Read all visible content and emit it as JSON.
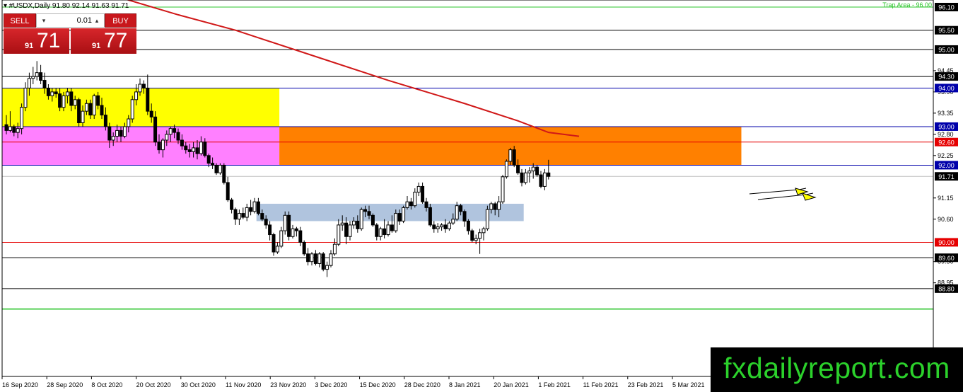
{
  "symbol_line": "▾ #USDX,Daily  91.80 92.14 91.63 91.71",
  "trade_panel": {
    "sell_label": "SELL",
    "buy_label": "BUY",
    "lot_value": "0.01",
    "lot_down_glyph": "▾",
    "lot_up_glyph": "▴",
    "sell_price_small": "91",
    "sell_price_big": "71",
    "buy_price_small": "91",
    "buy_price_big": "77"
  },
  "watermark": "fxdailyreport.com",
  "chart_data": {
    "type": "candlestick",
    "symbol": "#USDX",
    "timeframe": "Daily",
    "ylim": [
      88.5,
      96.15
    ],
    "price_ticks": [
      "94.45",
      "93.90",
      "93.35",
      "92.80",
      "92.25",
      "91.15",
      "90.60",
      "89.50",
      "88.95"
    ],
    "level_labels": [
      {
        "value": 96.1,
        "label": "96.10",
        "style": "solid",
        "color": "#000000",
        "line": "#2bc52b"
      },
      {
        "value": 95.5,
        "label": "95.50",
        "style": "solid",
        "color": "#000000",
        "line": "#000000"
      },
      {
        "value": 95.0,
        "label": "95.00",
        "style": "solid",
        "color": "#000000",
        "line": "#000000"
      },
      {
        "value": 94.3,
        "label": "94.30",
        "style": "solid",
        "color": "#000000",
        "line": "#000000"
      },
      {
        "value": 94.0,
        "label": "94.00",
        "style": "solid",
        "color": "#0000aa",
        "line": "#0000aa"
      },
      {
        "value": 93.0,
        "label": "93.00",
        "style": "solid",
        "color": "#0000aa",
        "line": "#0000aa"
      },
      {
        "value": 92.6,
        "label": "92.60",
        "style": "solid",
        "color": "#e60000",
        "line": "#e60000"
      },
      {
        "value": 92.0,
        "label": "92.00",
        "style": "solid",
        "color": "#0000aa",
        "line": "#0000aa"
      },
      {
        "value": 91.71,
        "label": "91.71",
        "style": "solid",
        "color": "#000000",
        "line": "#c0c0c0"
      },
      {
        "value": 90.0,
        "label": "90.00",
        "style": "solid",
        "color": "#e60000",
        "line": "#e60000"
      },
      {
        "value": 89.6,
        "label": "89.60",
        "style": "solid",
        "color": "#000000",
        "line": "#000000"
      },
      {
        "value": 88.8,
        "label": "88.80",
        "style": "solid",
        "color": "#000000",
        "line": "#000000"
      }
    ],
    "extra_lines": [
      {
        "value": 88.27,
        "color": "#2bc52b"
      }
    ],
    "annotations": [
      {
        "text": "Trap Area - 96.00",
        "color": "#2bc52b"
      }
    ],
    "zones": [
      {
        "name": "yellow",
        "x_from": 0,
        "x_to": 72,
        "y_from": 93.0,
        "y_to": 94.0,
        "color": "#ffff00"
      },
      {
        "name": "pink",
        "x_from": 0,
        "x_to": 72,
        "y_from": 92.0,
        "y_to": 93.0,
        "color": "#ff80ff"
      },
      {
        "name": "orange",
        "x_from": 72,
        "x_to": 193,
        "y_from": 92.0,
        "y_to": 93.0,
        "color": "#ff8000"
      },
      {
        "name": "steel-blue",
        "x_from": 66,
        "x_to": 136,
        "y_from": 90.55,
        "y_to": 91.0,
        "color": "#b0c4de"
      }
    ],
    "x_labels": [
      "16 Sep 2020",
      "28 Sep 2020",
      "8 Oct 2020",
      "20 Oct 2020",
      "30 Oct 2020",
      "11 Nov 2020",
      "23 Nov 2020",
      "3 Dec 2020",
      "15 Dec 2020",
      "28 Dec 2020",
      "8 Jan 2021",
      "20 Jan 2021",
      "1 Feb 2021",
      "11 Feb 2021",
      "23 Feb 2021",
      "5 Mar 2021"
    ],
    "candles": [
      [
        93.05,
        93.3,
        92.8,
        92.9
      ],
      [
        92.9,
        93.4,
        92.85,
        93.0
      ],
      [
        93.0,
        93.05,
        92.75,
        92.85
      ],
      [
        92.85,
        93.1,
        92.7,
        92.95
      ],
      [
        92.95,
        93.6,
        92.8,
        93.5
      ],
      [
        93.5,
        94.15,
        93.4,
        94.0
      ],
      [
        94.0,
        94.4,
        93.8,
        94.25
      ],
      [
        94.25,
        94.55,
        94.1,
        94.3
      ],
      [
        94.3,
        94.7,
        94.2,
        94.4
      ],
      [
        94.4,
        94.6,
        94.1,
        94.2
      ],
      [
        94.2,
        94.4,
        93.85,
        94.0
      ],
      [
        94.0,
        94.1,
        93.7,
        93.8
      ],
      [
        93.8,
        94.0,
        93.65,
        93.9
      ],
      [
        93.9,
        94.0,
        93.75,
        93.85
      ],
      [
        93.85,
        94.0,
        93.4,
        93.5
      ],
      [
        93.5,
        93.9,
        93.4,
        93.8
      ],
      [
        93.8,
        94.0,
        93.6,
        93.9
      ],
      [
        93.9,
        94.0,
        93.4,
        93.55
      ],
      [
        93.55,
        93.8,
        93.45,
        93.7
      ],
      [
        93.7,
        93.75,
        93.0,
        93.1
      ],
      [
        93.1,
        93.55,
        93.0,
        93.4
      ],
      [
        93.4,
        93.7,
        93.3,
        93.6
      ],
      [
        93.6,
        93.7,
        93.2,
        93.3
      ],
      [
        93.3,
        93.85,
        93.2,
        93.8
      ],
      [
        93.8,
        93.9,
        93.45,
        93.55
      ],
      [
        93.55,
        93.75,
        93.2,
        93.3
      ],
      [
        93.3,
        93.5,
        92.9,
        93.0
      ],
      [
        93.0,
        93.1,
        92.45,
        92.65
      ],
      [
        92.65,
        92.85,
        92.5,
        92.75
      ],
      [
        92.75,
        93.05,
        92.6,
        92.9
      ],
      [
        92.9,
        93.0,
        92.6,
        92.75
      ],
      [
        92.75,
        93.1,
        92.7,
        93.0
      ],
      [
        93.0,
        93.3,
        92.85,
        93.2
      ],
      [
        93.2,
        93.8,
        93.1,
        93.7
      ],
      [
        93.7,
        94.1,
        93.55,
        93.9
      ],
      [
        93.9,
        94.25,
        93.8,
        94.1
      ],
      [
        94.1,
        94.2,
        93.85,
        94.0
      ],
      [
        94.0,
        94.35,
        93.3,
        93.4
      ],
      [
        93.4,
        93.6,
        93.1,
        93.25
      ],
      [
        93.25,
        93.4,
        92.5,
        92.6
      ],
      [
        92.6,
        92.8,
        92.3,
        92.4
      ],
      [
        92.4,
        92.7,
        92.2,
        92.65
      ],
      [
        92.65,
        92.9,
        92.5,
        92.8
      ],
      [
        92.8,
        93.0,
        92.6,
        92.95
      ],
      [
        92.95,
        93.05,
        92.7,
        92.85
      ],
      [
        92.85,
        92.95,
        92.55,
        92.65
      ],
      [
        92.65,
        92.8,
        92.4,
        92.5
      ],
      [
        92.5,
        92.6,
        92.3,
        92.4
      ],
      [
        92.4,
        92.55,
        92.2,
        92.35
      ],
      [
        92.35,
        92.6,
        92.2,
        92.45
      ],
      [
        92.45,
        92.65,
        92.15,
        92.3
      ],
      [
        92.3,
        92.75,
        92.25,
        92.6
      ],
      [
        92.6,
        92.7,
        92.2,
        92.25
      ],
      [
        92.25,
        92.3,
        91.95,
        92.05
      ],
      [
        92.05,
        92.2,
        91.9,
        92.0
      ],
      [
        92.0,
        92.05,
        91.75,
        91.8
      ],
      [
        91.8,
        92.05,
        91.75,
        92.0
      ],
      [
        92.0,
        92.05,
        91.5,
        91.55
      ],
      [
        91.55,
        91.7,
        91.05,
        91.1
      ],
      [
        91.1,
        91.15,
        90.75,
        90.85
      ],
      [
        90.85,
        90.9,
        90.45,
        90.6
      ],
      [
        90.6,
        90.85,
        90.45,
        90.75
      ],
      [
        90.75,
        90.9,
        90.6,
        90.65
      ],
      [
        90.65,
        91.0,
        90.55,
        90.9
      ],
      [
        90.9,
        91.1,
        90.7,
        90.8
      ],
      [
        90.8,
        91.15,
        90.75,
        91.05
      ],
      [
        91.05,
        91.15,
        90.7,
        90.75
      ],
      [
        90.75,
        90.85,
        90.55,
        90.6
      ],
      [
        90.6,
        90.7,
        90.35,
        90.45
      ],
      [
        90.45,
        90.55,
        90.05,
        90.2
      ],
      [
        90.2,
        90.25,
        89.65,
        89.75
      ],
      [
        89.75,
        90.0,
        89.7,
        89.9
      ],
      [
        89.9,
        90.4,
        89.85,
        90.3
      ],
      [
        90.3,
        90.8,
        90.2,
        90.7
      ],
      [
        90.7,
        90.8,
        90.05,
        90.15
      ],
      [
        90.15,
        90.45,
        90.1,
        90.35
      ],
      [
        90.35,
        90.4,
        90.15,
        90.3
      ],
      [
        90.3,
        90.4,
        89.9,
        90.0
      ],
      [
        90.0,
        90.05,
        89.65,
        89.7
      ],
      [
        89.7,
        89.85,
        89.4,
        89.5
      ],
      [
        89.5,
        89.75,
        89.4,
        89.7
      ],
      [
        89.7,
        89.8,
        89.4,
        89.45
      ],
      [
        89.45,
        89.75,
        89.35,
        89.7
      ],
      [
        89.7,
        89.75,
        89.25,
        89.3
      ],
      [
        89.3,
        89.5,
        89.1,
        89.4
      ],
      [
        89.4,
        89.8,
        89.35,
        89.7
      ],
      [
        89.7,
        90.1,
        89.65,
        89.95
      ],
      [
        89.95,
        90.6,
        89.9,
        90.45
      ],
      [
        90.45,
        90.7,
        90.3,
        90.5
      ],
      [
        90.5,
        90.65,
        89.95,
        90.15
      ],
      [
        90.15,
        90.55,
        90.05,
        90.45
      ],
      [
        90.45,
        90.65,
        90.35,
        90.55
      ],
      [
        90.55,
        90.7,
        90.25,
        90.35
      ],
      [
        90.35,
        90.9,
        90.3,
        90.85
      ],
      [
        90.85,
        90.95,
        90.65,
        90.8
      ],
      [
        90.8,
        90.95,
        90.6,
        90.7
      ],
      [
        90.7,
        90.75,
        90.4,
        90.45
      ],
      [
        90.45,
        90.5,
        90.05,
        90.15
      ],
      [
        90.15,
        90.4,
        90.05,
        90.35
      ],
      [
        90.35,
        90.6,
        90.1,
        90.2
      ],
      [
        90.2,
        90.55,
        90.15,
        90.45
      ],
      [
        90.45,
        90.7,
        90.25,
        90.3
      ],
      [
        90.3,
        90.85,
        90.25,
        90.75
      ],
      [
        90.75,
        90.85,
        90.45,
        90.55
      ],
      [
        90.55,
        90.95,
        90.5,
        90.9
      ],
      [
        90.9,
        91.2,
        90.85,
        91.05
      ],
      [
        91.05,
        91.15,
        90.85,
        90.95
      ],
      [
        90.95,
        91.4,
        90.9,
        91.3
      ],
      [
        91.3,
        91.55,
        91.2,
        91.45
      ],
      [
        91.45,
        91.55,
        91.0,
        91.05
      ],
      [
        91.05,
        91.15,
        90.8,
        90.9
      ],
      [
        90.9,
        91.0,
        90.4,
        90.45
      ],
      [
        90.45,
        90.55,
        90.25,
        90.35
      ],
      [
        90.35,
        90.5,
        90.25,
        90.4
      ],
      [
        90.4,
        90.5,
        90.3,
        90.45
      ],
      [
        90.45,
        90.6,
        90.25,
        90.35
      ],
      [
        90.35,
        90.55,
        90.3,
        90.5
      ],
      [
        90.5,
        90.75,
        90.45,
        90.6
      ],
      [
        90.6,
        91.05,
        90.55,
        90.95
      ],
      [
        90.95,
        91.0,
        90.7,
        90.8
      ],
      [
        90.8,
        90.85,
        90.4,
        90.55
      ],
      [
        90.55,
        90.6,
        90.2,
        90.3
      ],
      [
        90.3,
        90.35,
        90.0,
        90.05
      ],
      [
        90.05,
        90.2,
        89.95,
        90.1
      ],
      [
        90.1,
        90.35,
        89.7,
        90.25
      ],
      [
        90.25,
        90.4,
        90.05,
        90.35
      ],
      [
        90.35,
        90.95,
        90.3,
        90.85
      ],
      [
        90.85,
        91.05,
        90.75,
        91.0
      ],
      [
        91.0,
        91.05,
        90.7,
        90.85
      ],
      [
        90.85,
        91.2,
        90.65,
        91.05
      ],
      [
        91.05,
        91.75,
        91.0,
        91.7
      ],
      [
        91.7,
        92.15,
        91.65,
        92.1
      ],
      [
        92.1,
        92.45,
        92.0,
        92.4
      ],
      [
        92.4,
        92.5,
        91.95,
        92.0
      ],
      [
        92.0,
        92.15,
        91.75,
        91.8
      ],
      [
        91.8,
        91.9,
        91.45,
        91.55
      ],
      [
        91.55,
        91.9,
        91.5,
        91.8
      ],
      [
        91.8,
        91.95,
        91.55,
        91.85
      ],
      [
        91.85,
        92.05,
        91.65,
        91.95
      ],
      [
        91.95,
        92.0,
        91.7,
        91.75
      ],
      [
        91.75,
        91.85,
        91.4,
        91.45
      ],
      [
        91.45,
        91.9,
        91.35,
        91.8
      ],
      [
        91.8,
        92.14,
        91.63,
        91.71
      ]
    ],
    "moving_average": {
      "color": "#d01818",
      "points": [
        [
          28,
          96.4
        ],
        [
          45,
          95.9
        ],
        [
          60,
          95.5
        ],
        [
          80,
          94.85
        ],
        [
          100,
          94.2
        ],
        [
          120,
          93.6
        ],
        [
          134,
          93.15
        ],
        [
          142,
          92.85
        ],
        [
          150,
          92.75
        ]
      ]
    }
  }
}
